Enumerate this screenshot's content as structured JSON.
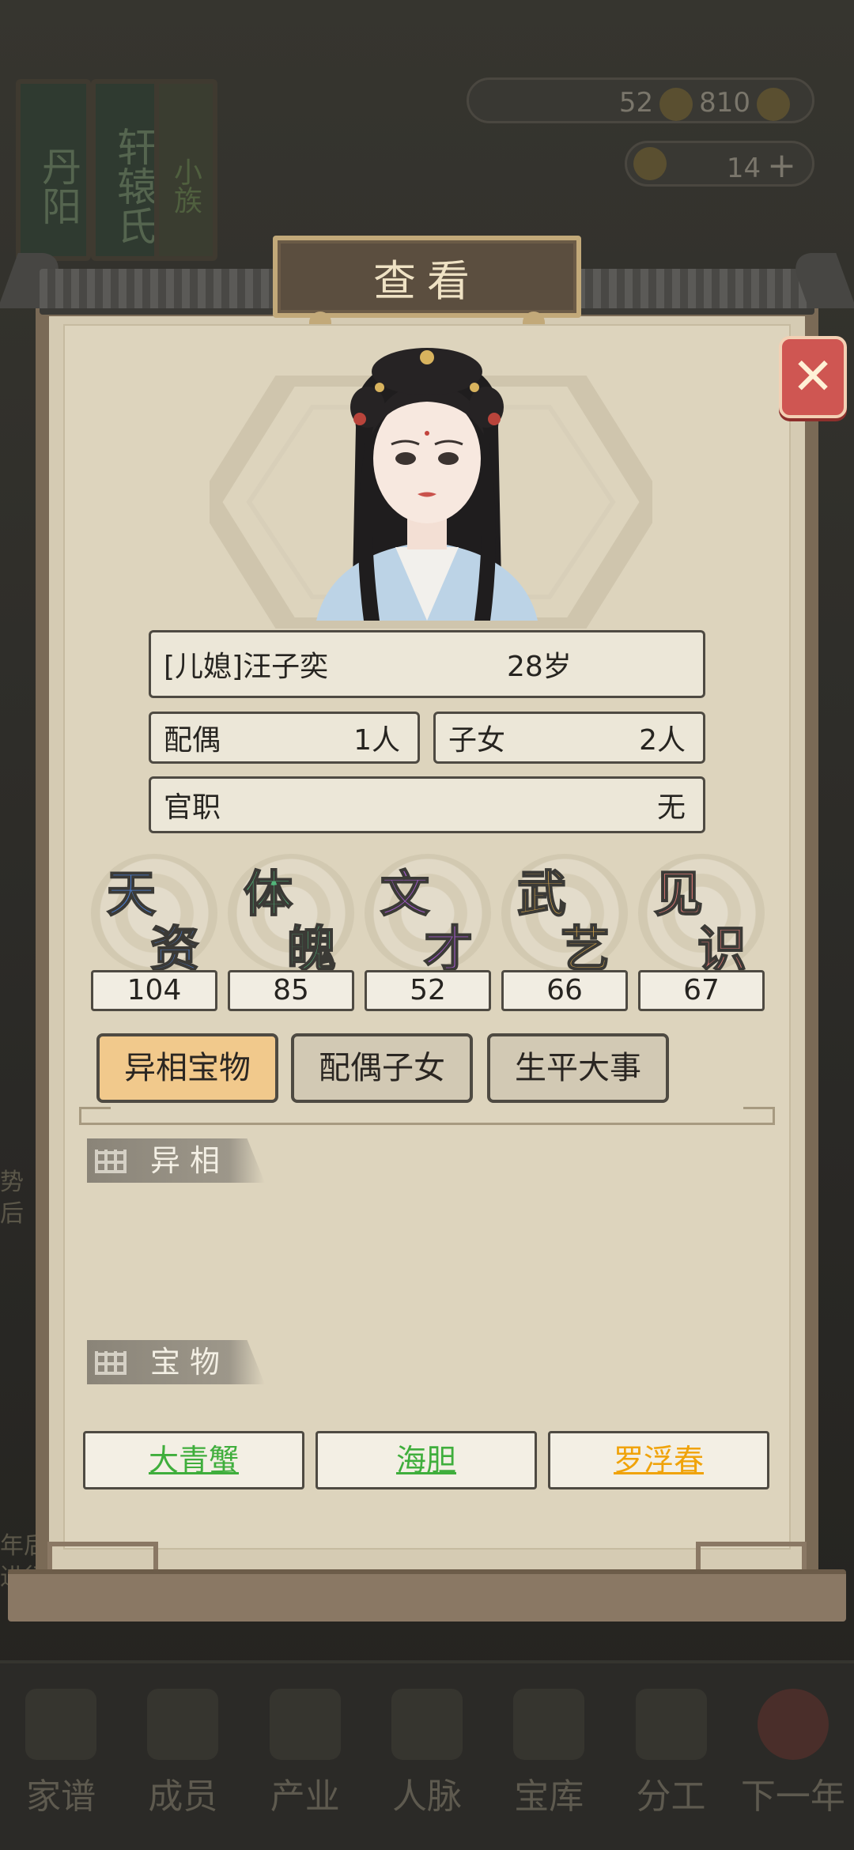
{
  "background": {
    "signs": [
      "丹阳",
      "轩辕氏",
      "小族"
    ],
    "resources": {
      "silver": "52",
      "gold": "810",
      "ingot": "14"
    },
    "side_texts": [
      "势",
      "后",
      "年后",
      "进行"
    ],
    "bottom_nav": [
      "家谱",
      "成员",
      "产业",
      "人脉",
      "宝库",
      "分工",
      "下一年"
    ]
  },
  "dialog": {
    "title": "查看",
    "close_label": "✕"
  },
  "character": {
    "name": "[儿媳]汪子奕",
    "age": "28岁",
    "spouse_label": "配偶",
    "spouse_value": "1人",
    "children_label": "子女",
    "children_value": "2人",
    "office_label": "官职",
    "office_value": "无"
  },
  "attributes": [
    {
      "c1": "天",
      "c2": "资",
      "value": "104",
      "color": "#4a7fd6"
    },
    {
      "c1": "体",
      "c2": "魄",
      "value": "85",
      "color": "#52b57a"
    },
    {
      "c1": "文",
      "c2": "才",
      "value": "52",
      "color": "#a159c9"
    },
    {
      "c1": "武",
      "c2": "艺",
      "value": "66",
      "color": "#d9a84d"
    },
    {
      "c1": "见",
      "c2": "识",
      "value": "67",
      "color": "#e07a76"
    }
  ],
  "tabs": [
    "异相宝物",
    "配偶子女",
    "生平大事"
  ],
  "sections": {
    "yixiang": "异相",
    "baowu": "宝物"
  },
  "treasures": [
    {
      "name": "大青蟹",
      "color": "#3fae3c"
    },
    {
      "name": "海胆",
      "color": "#3fae3c"
    },
    {
      "name": "罗浮春",
      "color": "#f0a30a"
    }
  ]
}
